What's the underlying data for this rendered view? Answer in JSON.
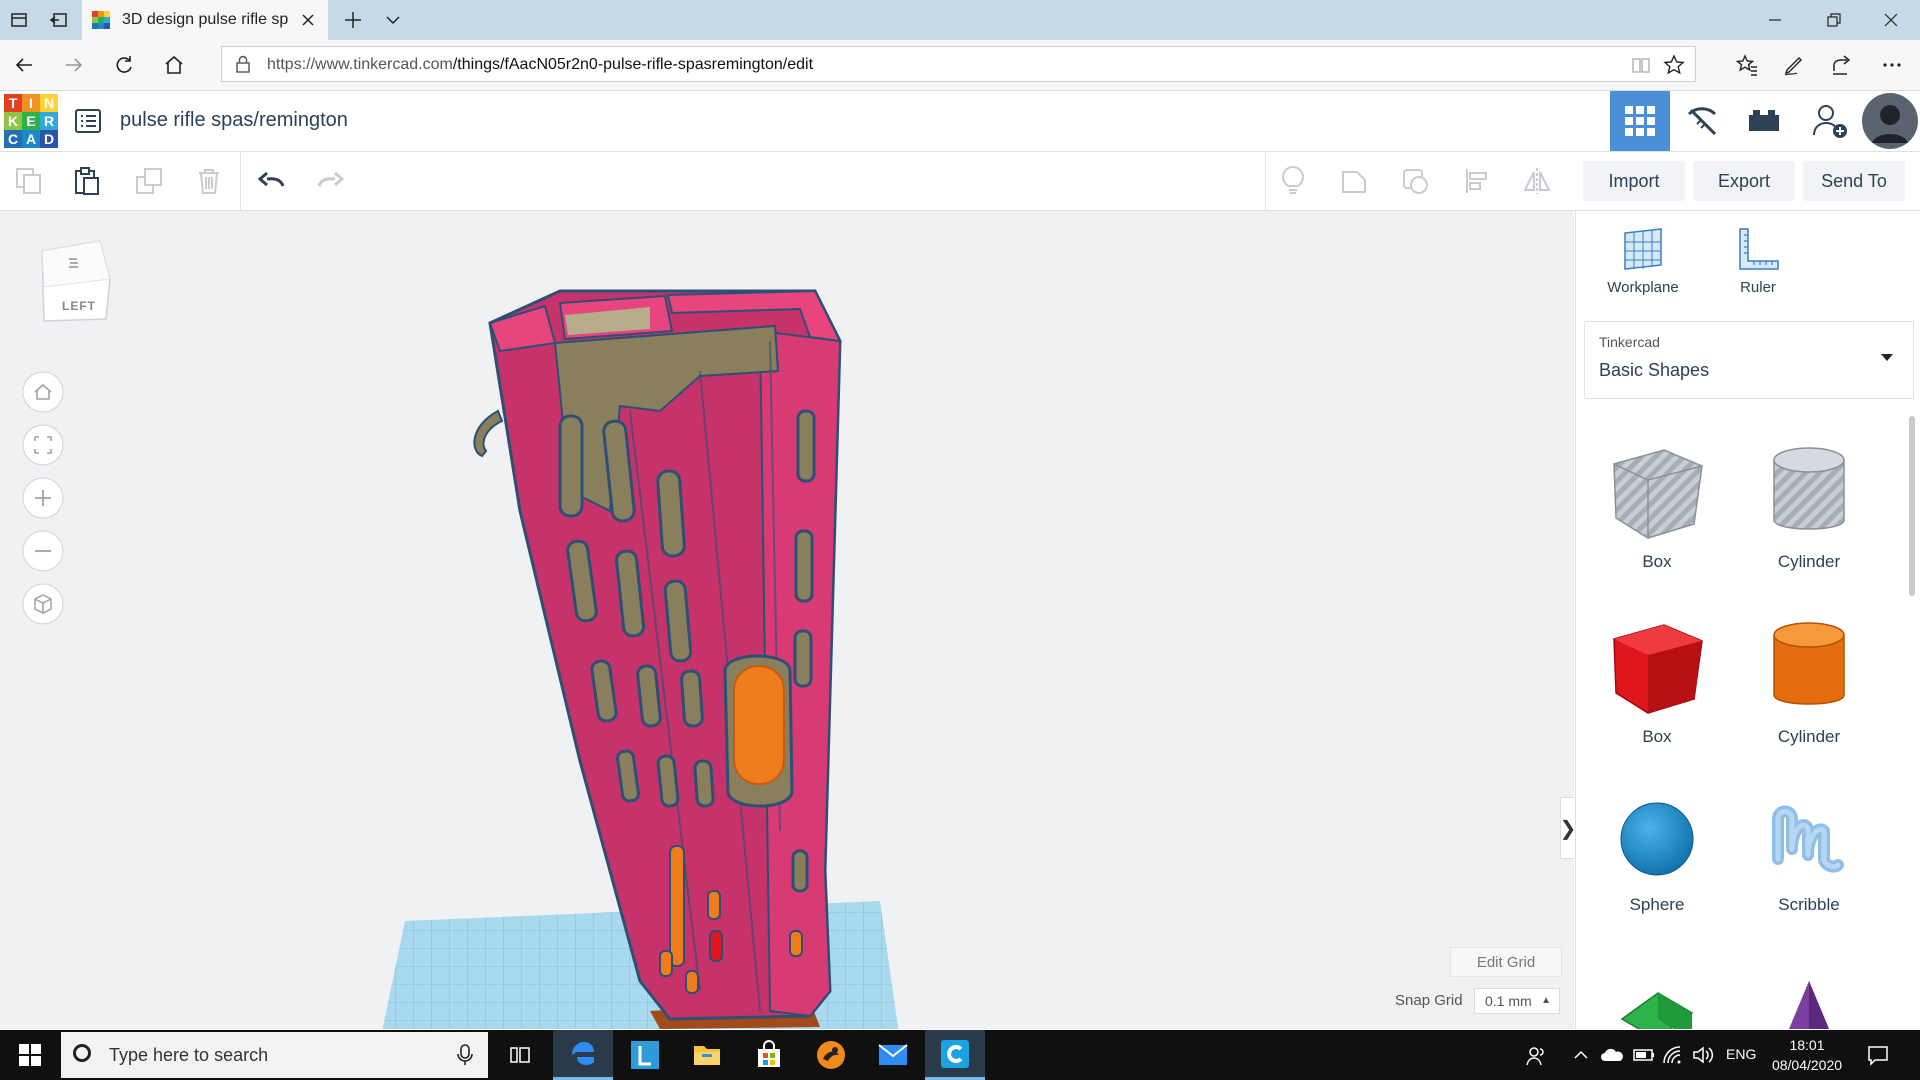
{
  "browser": {
    "tab_title": "3D design pulse rifle sp",
    "url_host": "https://www.tinkercad.com",
    "url_path": "/things/fAacN05r2n0-pulse-rifle-spasremington/edit"
  },
  "app": {
    "logo_letters": [
      "T",
      "I",
      "N",
      "K",
      "E",
      "R",
      "C",
      "A",
      "D"
    ],
    "logo_colors": [
      "#e2411f",
      "#f29021",
      "#ffd332",
      "#8ec544",
      "#2bb24c",
      "#32a9dd",
      "#2370b6",
      "#1e88c9",
      "#2b56a6"
    ],
    "design_title": "pulse rifle spas/remington"
  },
  "toolbar": {
    "import_label": "Import",
    "export_label": "Export",
    "send_to_label": "Send To"
  },
  "canvas": {
    "viewcube_face": "LEFT",
    "edit_grid_label": "Edit Grid",
    "snap_grid_label": "Snap Grid",
    "snap_grid_value": "0.1 mm"
  },
  "panel": {
    "tools": [
      {
        "label": "Workplane",
        "icon": "workplane-icon"
      },
      {
        "label": "Ruler",
        "icon": "ruler-icon"
      }
    ],
    "library_category": "Tinkercad",
    "library_name": "Basic Shapes",
    "shapes": [
      {
        "label": "Box",
        "icon": "box-hole-icon"
      },
      {
        "label": "Cylinder",
        "icon": "cylinder-hole-icon"
      },
      {
        "label": "Box",
        "icon": "box-icon",
        "color": "#e0161d"
      },
      {
        "label": "Cylinder",
        "icon": "cylinder-icon",
        "color": "#f07d1b"
      },
      {
        "label": "Sphere",
        "icon": "sphere-icon",
        "color": "#1a8fd0"
      },
      {
        "label": "Scribble",
        "icon": "scribble-icon",
        "color": "#8fbee7"
      }
    ]
  },
  "taskbar": {
    "search_placeholder": "Type here to search",
    "language": "ENG",
    "time": "18:01",
    "date": "08/04/2020"
  },
  "colors": {
    "accent": "#4c8fd9",
    "model_magenta": "#c5336a",
    "model_pink": "#e8447e",
    "model_olive": "#8a7f5c",
    "model_orange": "#f07d1b",
    "grid_blue": "#a9d9ef"
  }
}
